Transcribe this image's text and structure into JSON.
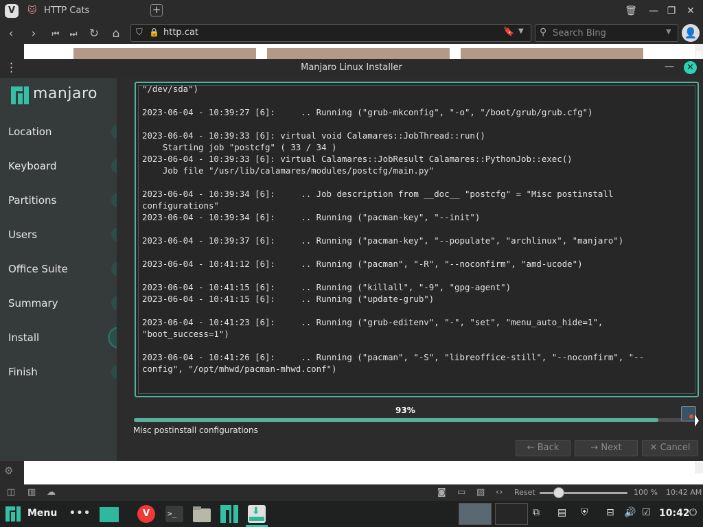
{
  "browser": {
    "tab_title": "HTTP Cats",
    "url": "http.cat",
    "search_placeholder": "Search Bing",
    "status": {
      "reset_label": "Reset",
      "zoom": "100 %",
      "time": "10:42 AM"
    }
  },
  "installer": {
    "title": "Manjaro Linux Installer",
    "logo_text": "manjaro",
    "steps": [
      {
        "label": "Location",
        "done": true
      },
      {
        "label": "Keyboard",
        "done": true
      },
      {
        "label": "Partitions",
        "done": true
      },
      {
        "label": "Users",
        "done": true
      },
      {
        "label": "Office Suite",
        "done": true
      },
      {
        "label": "Summary",
        "done": true
      },
      {
        "label": "Install",
        "active": true
      },
      {
        "label": "Finish",
        "done": false
      }
    ],
    "log": "\"/dev/sda\")\n\n2023-06-04 - 10:39:27 [6]:     .. Running (\"grub-mkconfig\", \"-o\", \"/boot/grub/grub.cfg\")\n\n2023-06-04 - 10:39:33 [6]: virtual void Calamares::JobThread::run()\n    Starting job \"postcfg\" ( 33 / 34 )\n2023-06-04 - 10:39:33 [6]: virtual Calamares::JobResult Calamares::PythonJob::exec()\n    Job file \"/usr/lib/calamares/modules/postcfg/main.py\"\n\n2023-06-04 - 10:39:34 [6]:     .. Job description from __doc__ \"postcfg\" = \"Misc postinstall\nconfigurations\"\n2023-06-04 - 10:39:34 [6]:     .. Running (\"pacman-key\", \"--init\")\n\n2023-06-04 - 10:39:37 [6]:     .. Running (\"pacman-key\", \"--populate\", \"archlinux\", \"manjaro\")\n\n2023-06-04 - 10:41:12 [6]:     .. Running (\"pacman\", \"-R\", \"--noconfirm\", \"amd-ucode\")\n\n2023-06-04 - 10:41:15 [6]:     .. Running (\"killall\", \"-9\", \"gpg-agent\")\n2023-06-04 - 10:41:15 [6]:     .. Running (\"update-grub\")\n\n2023-06-04 - 10:41:23 [6]:     .. Running (\"grub-editenv\", \"-\", \"set\", \"menu_auto_hide=1\",\n\"boot_success=1\")\n\n2023-06-04 - 10:41:26 [6]:     .. Running (\"pacman\", \"-S\", \"libreoffice-still\", \"--noconfirm\", \"--\nconfig\", \"/opt/mhwd/pacman-mhwd.conf\")",
    "progress_percent": 93,
    "progress_label": "93%",
    "status_text": "Misc postinstall configurations",
    "buttons": {
      "back": "Back",
      "next": "Next",
      "cancel": "Cancel"
    }
  },
  "taskbar": {
    "menu_label": "Menu",
    "clock": "10:42"
  },
  "colors": {
    "accent": "#35bfa4",
    "progress": "#57b09b",
    "sidebar": "#353b3a"
  }
}
